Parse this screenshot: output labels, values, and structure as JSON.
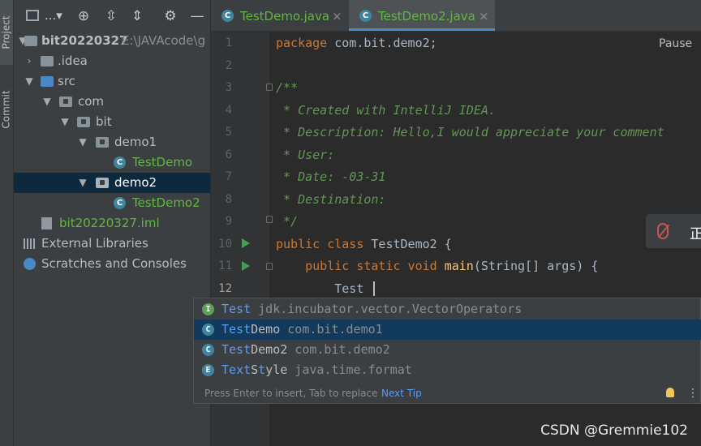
{
  "toolstrip": {
    "project_tab": "Project",
    "commit_tab": "Commit"
  },
  "project_toolbar": {
    "view_selector": "...▾",
    "icons": [
      "locate-icon",
      "expand-all-icon",
      "collapse-all-icon",
      "gear-icon",
      "minimize-icon"
    ]
  },
  "project_tree": {
    "root_name": "bit20220327",
    "root_path": "E:\\JAVAcode\\g",
    "items": [
      {
        "label": ".idea"
      },
      {
        "label": "src"
      },
      {
        "label": "com"
      },
      {
        "label": "bit"
      },
      {
        "label": "demo1"
      },
      {
        "label": "TestDemo"
      },
      {
        "label": "demo2"
      },
      {
        "label": "TestDemo2"
      },
      {
        "label": "bit20220327.iml"
      },
      {
        "label": "External Libraries"
      },
      {
        "label": "Scratches and Consoles"
      }
    ]
  },
  "editor_tabs": [
    {
      "label": "TestDemo.java",
      "close": "×"
    },
    {
      "label": "TestDemo2.java",
      "close": "×"
    }
  ],
  "editor": {
    "line_numbers": [
      "1",
      "2",
      "3",
      "4",
      "5",
      "6",
      "7",
      "8",
      "9",
      "10",
      "11",
      "12"
    ],
    "lines": {
      "l1": {
        "kw": "package",
        "rest": " com.bit.demo2;"
      },
      "l3": "/**",
      "l4": " * Created with IntelliJ IDEA.",
      "l5": " * Description: Hello,I would appreciate your comment",
      "l6": " * User:",
      "l7": " * Date: -03-31",
      "l8": " * Destination:",
      "l9": " */",
      "l10": {
        "kw": "public class",
        "rest": " TestDemo2 {"
      },
      "l11": {
        "indent": "    ",
        "kw": "public static void",
        "fn": " main",
        "rest": "(String[] args) {"
      },
      "l12": "        Test"
    },
    "pause_label": "Pause",
    "mic_text": "正"
  },
  "completion": {
    "items": [
      {
        "icon": "I",
        "icon_color": "#5f9f5a",
        "match": "Test",
        "name": "",
        "detail": " jdk.incubator.vector.VectorOperators"
      },
      {
        "icon": "C",
        "icon_color": "#3e86a0",
        "match": "Test",
        "name": "Demo",
        "detail": " com.bit.demo1"
      },
      {
        "icon": "C",
        "icon_color": "#3e86a0",
        "match": "Test",
        "name": "Demo2",
        "detail": " com.bit.demo2"
      },
      {
        "icon": "E",
        "icon_color": "#3e86a0",
        "match": "Te",
        "match2": "xt",
        "mid": "S",
        "match3": "t",
        "name": "yle",
        "detail": " java.time.format"
      }
    ],
    "footer_text": "Press Enter to insert, Tab to replace",
    "next_tip": "Next Tip",
    "more": "⋮"
  },
  "watermark": "CSDN @Gremmie102"
}
